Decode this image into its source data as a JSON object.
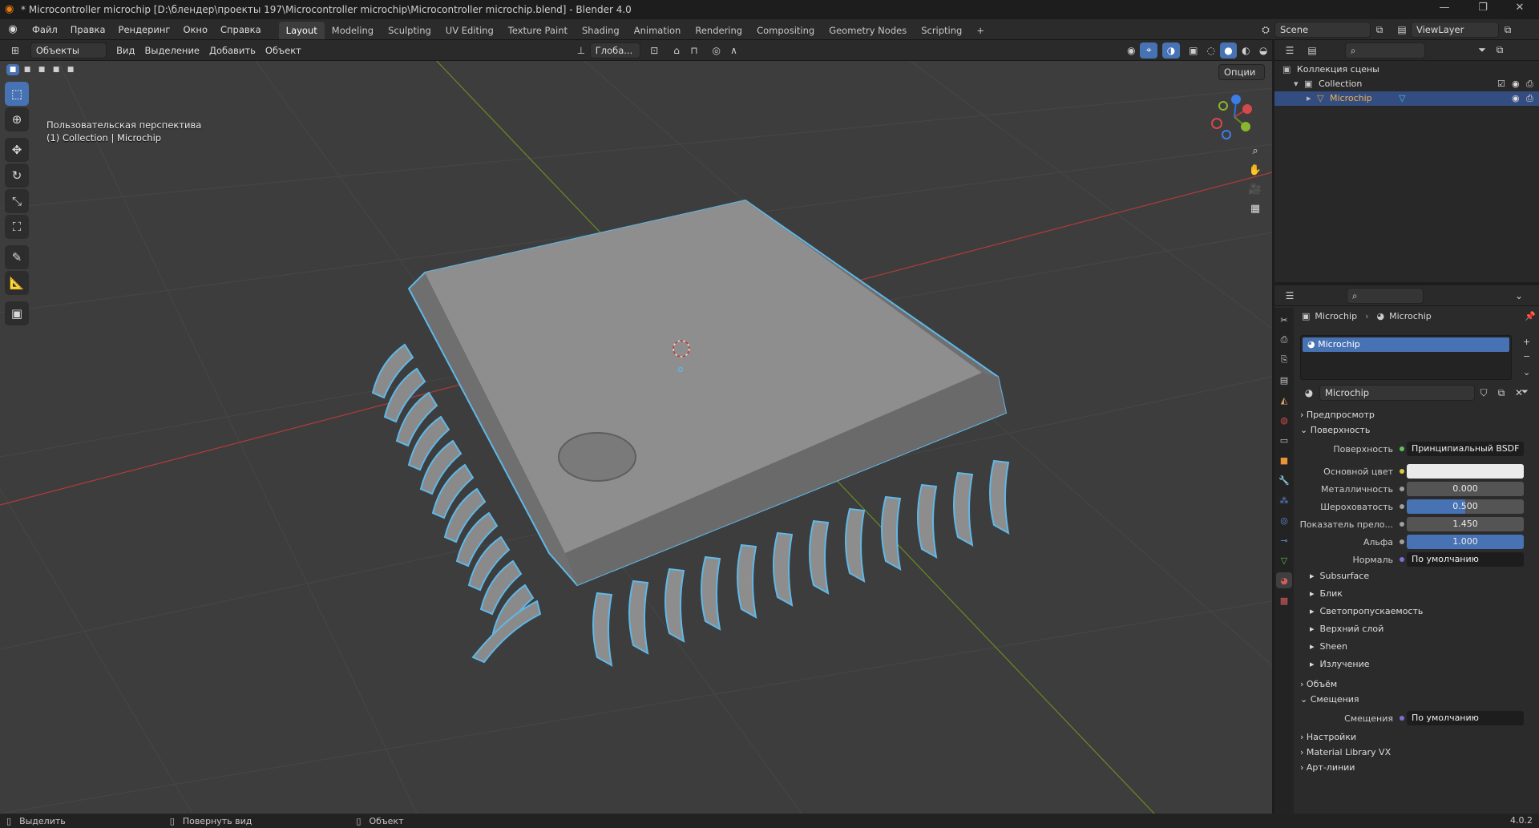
{
  "window": {
    "title": "* Microcontroller microchip [D:\\блендер\\проекты 197\\Microcontroller microchip\\Microcontroller microchip.blend] - Blender 4.0",
    "minimize": "—",
    "maximize": "❐",
    "close": "✕"
  },
  "menu": {
    "items": [
      "Файл",
      "Правка",
      "Рендеринг",
      "Окно",
      "Справка"
    ],
    "workspaces": [
      "Layout",
      "Modeling",
      "Sculpting",
      "UV Editing",
      "Texture Paint",
      "Shading",
      "Animation",
      "Rendering",
      "Compositing",
      "Geometry Nodes",
      "Scripting"
    ],
    "active_workspace": "Layout",
    "add_tab": "+",
    "scene": "Scene",
    "view_layer": "ViewLayer"
  },
  "viewport": {
    "mode": "Объекты",
    "menus": [
      "Вид",
      "Выделение",
      "Добавить",
      "Объект"
    ],
    "transform_orientation": "Глоба...",
    "options": "Опции",
    "overlay_line1": "Пользовательская перспектива",
    "overlay_line2": "(1) Collection | Microchip",
    "gizmo_axes": [
      "X",
      "Y",
      "Z"
    ],
    "accent_color": "#4772b3",
    "selection_outline": "#5fb8e8"
  },
  "outliner": {
    "root": "Коллекция сцены",
    "collection": "Collection",
    "object": "Microchip"
  },
  "properties": {
    "breadcrumb_object": "Microchip",
    "breadcrumb_material": "Microchip",
    "slot_name": "Microchip",
    "material_name": "Microchip",
    "sections": {
      "preview": "Предпросмотр",
      "surface": "Поверхность",
      "volume": "Объём",
      "displacement": "Смещения",
      "settings": "Настройки",
      "material_library": "Material Library VX",
      "line_art": "Арт-линии"
    },
    "surface_label": "Поверхность",
    "surface_value": "Принципиальный BSDF",
    "fields": [
      {
        "label": "Основной цвет",
        "value": ""
      },
      {
        "label": "Металличность",
        "value": "0.000"
      },
      {
        "label": "Шероховатость",
        "value": "0.500"
      },
      {
        "label": "Показатель прело...",
        "value": "1.450"
      },
      {
        "label": "Альфа",
        "value": "1.000"
      },
      {
        "label": "Нормаль",
        "value": "По умолчанию"
      }
    ],
    "subsections": [
      "Subsurface",
      "Блик",
      "Светопропускаемость",
      "Верхний слой",
      "Sheen",
      "Излучение"
    ],
    "displacement_label": "Смещения",
    "displacement_value": "По умолчанию"
  },
  "statusbar": {
    "select": "Выделить",
    "rotate": "Повернуть вид",
    "object": "Объект",
    "version": "4.0.2"
  }
}
